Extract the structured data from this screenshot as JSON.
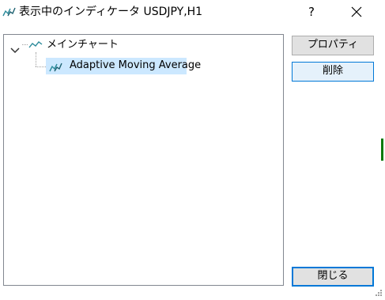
{
  "window": {
    "title": "表示中のインディケータ USDJPY,H1",
    "help_label": "?"
  },
  "tree": {
    "root": {
      "label": "メインチャート",
      "icon": "chart-line-icon",
      "expanded": true
    },
    "children": [
      {
        "label": "Adaptive Moving Average",
        "icon": "indicator-icon",
        "selected": true
      }
    ]
  },
  "buttons": {
    "properties": "プロパティ",
    "delete": "削除",
    "close": "閉じる"
  },
  "colors": {
    "selection": "#cce8ff",
    "accent_border": "#0078d7",
    "icon_teal": "#2a8a9a",
    "button_face": "#e1e1e1"
  }
}
